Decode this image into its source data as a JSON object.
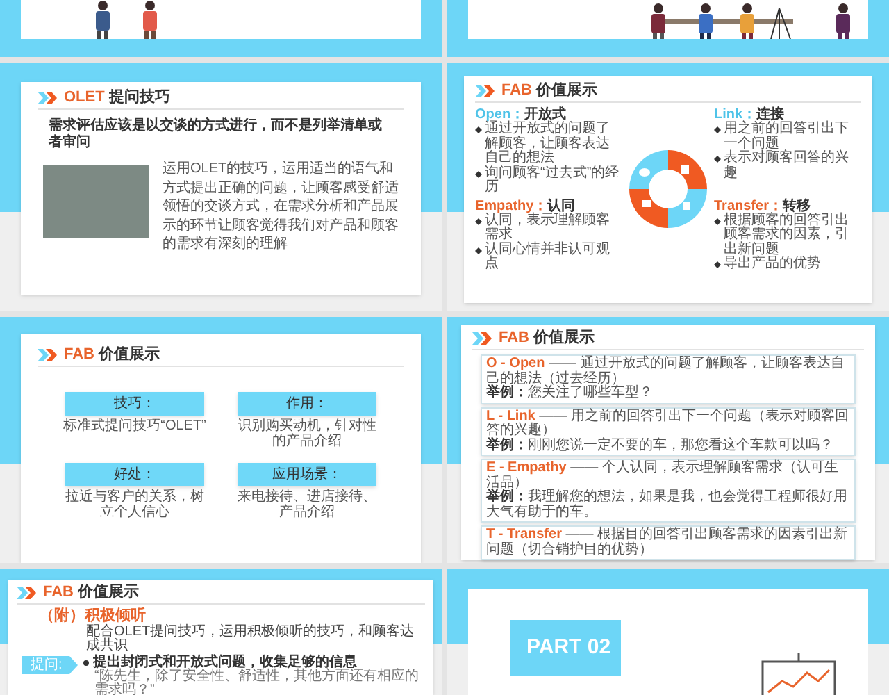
{
  "slides": [
    {
      "kind": "illustration"
    },
    {
      "kind": "illustration"
    },
    {
      "kind": "photo-text",
      "accent": "OLET",
      "title": "提问技巧",
      "lead": "需求评估应该是以交谈的方式进行，而不是列举清单或者审问",
      "body": "运用OLET的技巧，运用适当的语气和方式提出正确的问题，让顾客感受舒适领悟的交谈方式，在需求分析和产品展示的环节让顾客觉得我们对产品和顾客的需求有深刻的理解"
    },
    {
      "kind": "donut",
      "accent": "FAB",
      "title": "价值展示",
      "quadrants": [
        {
          "name": "Open：",
          "name_cn": "开放式",
          "color": "#4fc3e8",
          "bullets": [
            "通过开放式的问题了解顾客，让顾客表达自己的想法",
            "询问顾客“过去式”的经历"
          ]
        },
        {
          "name": "Link：",
          "name_cn": "连接",
          "color": "#4fc3e8",
          "bullets": [
            "用之前的回答引出下一个问题",
            "表示对顾客回答的兴趣"
          ]
        },
        {
          "name": "Empathy：",
          "name_cn": "认同",
          "color": "#e8642c",
          "bullets": [
            "认同，表示理解顾客需求",
            "认同心情并非认可观点"
          ]
        },
        {
          "name": "Transfer：",
          "name_cn": "转移",
          "color": "#e8642c",
          "bullets": [
            "根据顾客的回答引出顾客需求的因素，引出新问题",
            "导出产品的优势"
          ]
        }
      ]
    },
    {
      "kind": "cards",
      "accent": "FAB",
      "title": "价值展示",
      "items": [
        {
          "label": "技巧：",
          "text": "标准式提问技巧“OLET”"
        },
        {
          "label": "作用：",
          "text": "识别购买动机，针对性的产品介绍"
        },
        {
          "label": "好处：",
          "text": "拉近与客户的关系，树立个人信心"
        },
        {
          "label": "应用场景：",
          "text": "来电接待、进店接待、产品介绍"
        }
      ]
    },
    {
      "kind": "list",
      "accent": "FAB",
      "title": "价值展示",
      "items": [
        {
          "head": "O - Open",
          "text": "—— 通过开放式的问题了解顾客，让顾客表达自己的想法（过去经历）",
          "example_label": "举例：",
          "example": "您关注了哪些车型？"
        },
        {
          "head": "L - Link",
          "text": "—— 用之前的回答引出下一个问题（表示对顾客回答的兴趣）",
          "example_label": "举例：",
          "example": "刚刚您说一定不要的车，那您看这个车款可以吗？"
        },
        {
          "head": "E - Empathy",
          "text": "—— 个人认同，表示理解顾客需求（认可生活品）",
          "example_label": "举例：",
          "example": "我理解您的想法，如果是我，也会觉得工程师很好用大气有助于的车。"
        },
        {
          "head": "T - Transfer",
          "text": "—— 根据目的回答引出顾客需求的因素引出新问题（切合销护目的优势）"
        }
      ]
    },
    {
      "kind": "listen",
      "accent": "FAB",
      "title": "价值展示",
      "subtitle": "（附）积极倾听",
      "intro": "配合OLET提问技巧，运用积极倾听的技巧，和顾客达成共识",
      "steps": [
        {
          "label": "提问:",
          "bullet": "提出封闭式和开放式问题，收集足够的信息",
          "sub": "“陈先生，除了安全性、舒适性，其他方面还有相应的需求吗？”"
        }
      ]
    },
    {
      "kind": "part",
      "label": "PART 02"
    }
  ]
}
